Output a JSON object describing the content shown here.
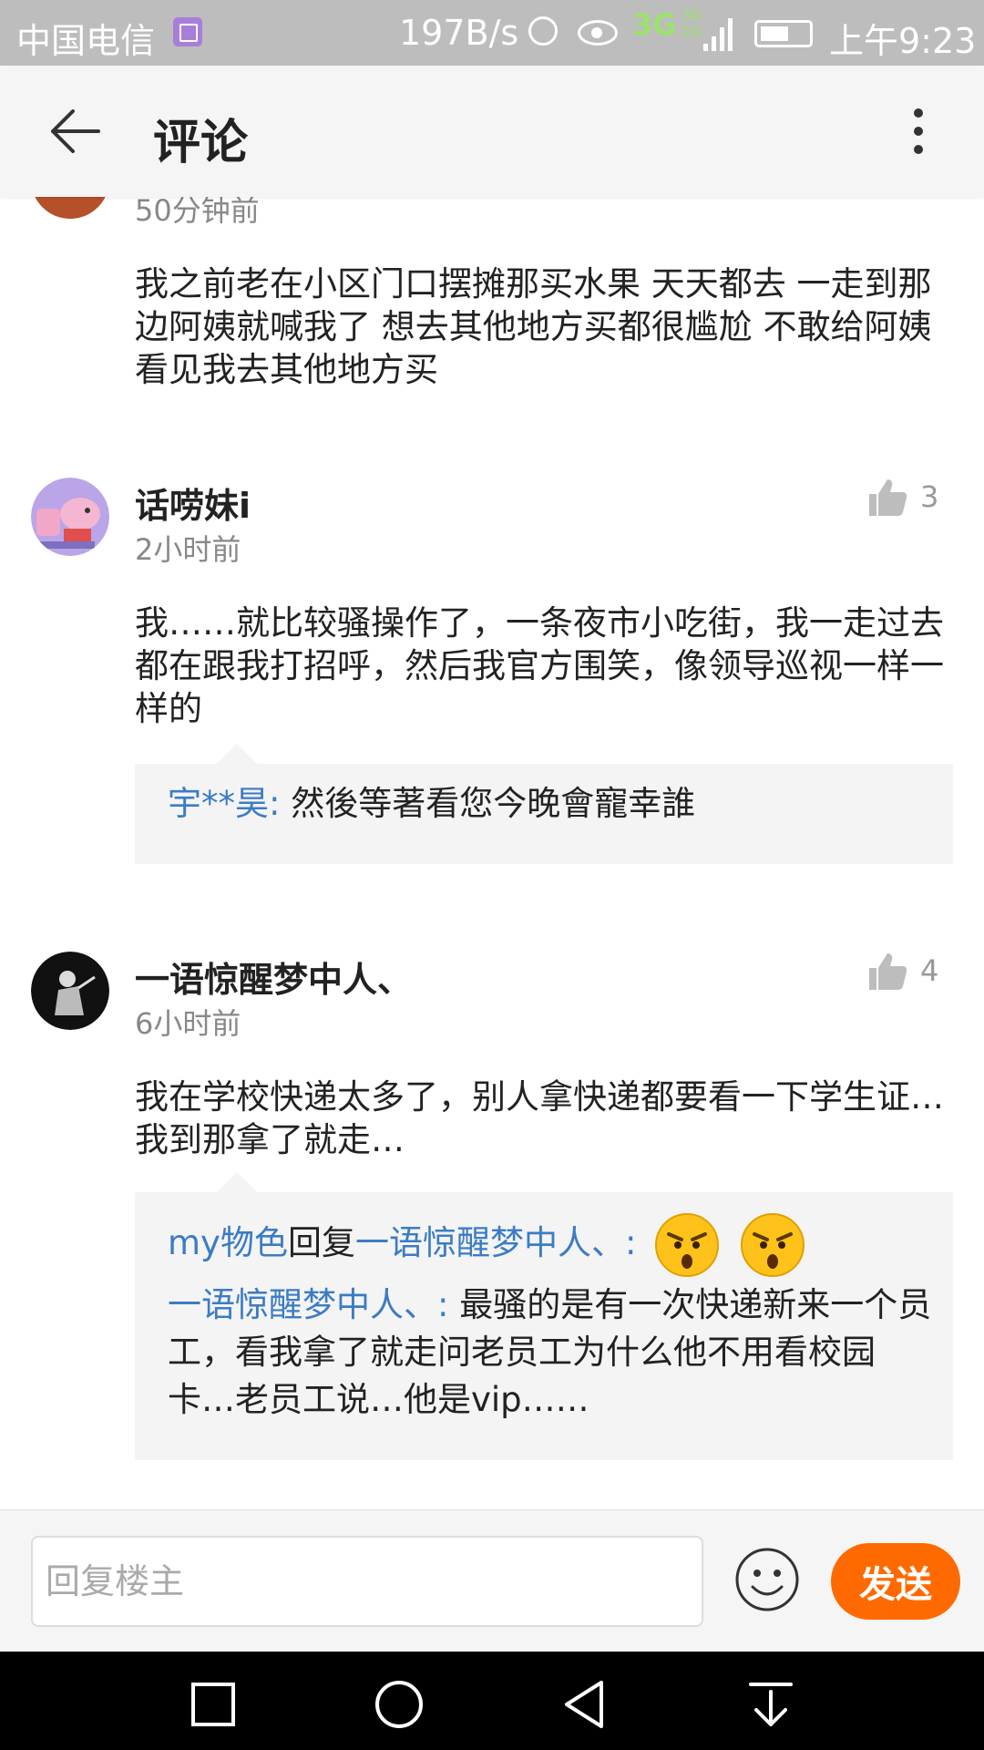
{
  "status_bar": {
    "carrier": "中国电信",
    "speed": "197B/s",
    "network": "3G",
    "network_small": "3G 2G",
    "time": "上午9:23"
  },
  "header": {
    "title": "评论"
  },
  "comments": [
    {
      "time": "50分钟前",
      "body": "我之前老在小区门口摆摊那买水果 天天都去 一走到那边阿姨就喊我了  想去其他地方买都很尴尬 不敢给阿姨看见我去其他地方买"
    },
    {
      "username": "话唠妹i",
      "time": "2小时前",
      "likes": "3",
      "body": "我……就比较骚操作了，一条夜市小吃街，我一走过去都在跟我打招呼，然后我官方围笑，像领导巡视一样一样的",
      "replies": [
        {
          "name": "宇**昊:",
          "text": "然後等著看您今晚會寵幸誰"
        }
      ]
    },
    {
      "username": "一语惊醒梦中人、",
      "time": "6小时前",
      "likes": "4",
      "body": "我在学校快递太多了，别人拿快递都要看一下学生证…我到那拿了就走…",
      "replies": [
        {
          "name": "my物色",
          "connector": "回复",
          "target": "一语惊醒梦中人、:"
        },
        {
          "name": "一语惊醒梦中人、:",
          "text": "最骚的是有一次快递新来一个员工，看我拿了就走问老员工为什么他不用看校园卡…老员工说…他是vip……"
        }
      ]
    }
  ],
  "composer": {
    "placeholder": "回复楼主",
    "send_label": "发送"
  },
  "colors": {
    "accent": "#ff6a00",
    "reply_name": "#3b7cc4"
  }
}
